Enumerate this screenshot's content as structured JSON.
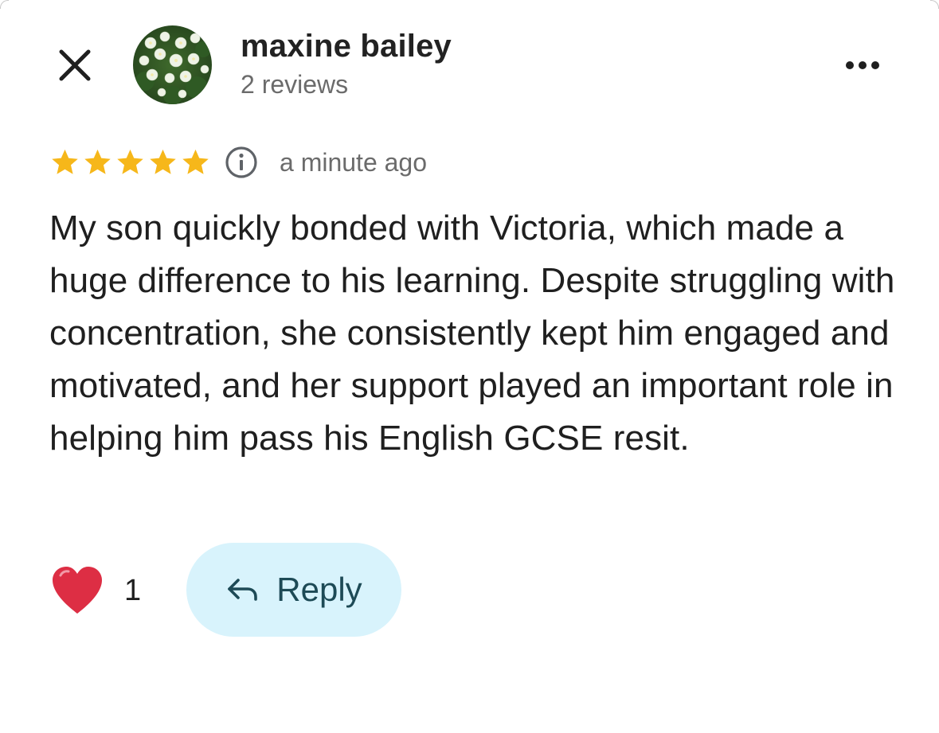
{
  "reviewer": {
    "name": "maxine bailey",
    "meta": "2 reviews"
  },
  "rating": {
    "stars": 5,
    "max_stars": 5,
    "time_ago": "a minute ago"
  },
  "review": {
    "text": "My son quickly bonded with Victoria, which made a huge difference to his learning. Despite struggling with concentration, she consistently kept him engaged and motivated, and her support played an important role in helping him pass his English GCSE resit."
  },
  "reactions": {
    "icon": "heart-icon",
    "count": "1"
  },
  "actions": {
    "reply_label": "Reply",
    "close_icon": "close-icon",
    "more_icon": "more-options-icon"
  },
  "colors": {
    "star": "#f6b71a",
    "reply_bg": "#d8f3fc",
    "reply_text": "#1d4a56",
    "heart": "#dd2e44",
    "muted_text": "#6b6b6b"
  }
}
